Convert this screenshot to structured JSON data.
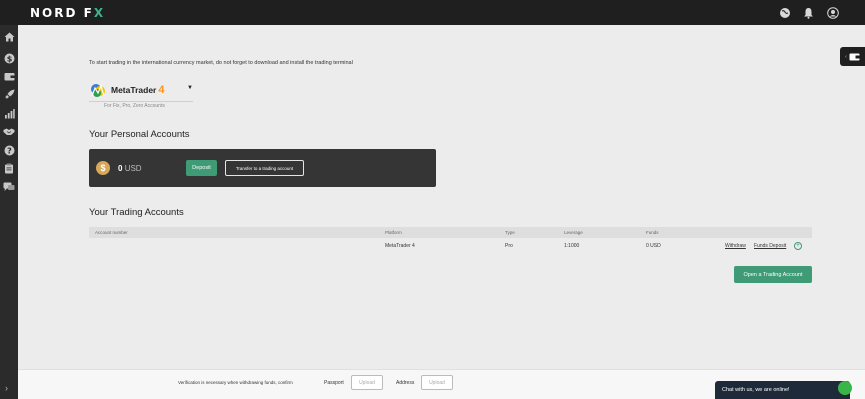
{
  "app": {
    "logo_left": "NORD F",
    "logo_right": "X"
  },
  "topbar": {
    "icons": [
      "globe-icon",
      "bell-icon",
      "user-icon"
    ]
  },
  "sidebar": {
    "icons": [
      "home-icon",
      "dollar-icon",
      "wallet-icon",
      "rocket-icon",
      "chart-icon",
      "handshake-icon",
      "help-icon",
      "clipboard-icon",
      "chat-icon"
    ],
    "expand": "›"
  },
  "intro": "To start trading in the international currency market, do not forget to download and install the trading terminal",
  "platform": {
    "name": "MetaTrader",
    "version": "4",
    "subtitle": "For Fix, Pro, Zero Accounts"
  },
  "personal": {
    "heading": "Your Personal Accounts",
    "balance": "0",
    "currency": "USD",
    "deposit_label": "Deposit",
    "transfer_label": "Transfer to a trading account"
  },
  "trading": {
    "heading": "Your Trading Accounts",
    "columns": [
      "Account number",
      "Platform",
      "Type",
      "Leverage",
      "Funds"
    ],
    "rows": [
      {
        "account": "",
        "platform": "MetaTrader 4",
        "type": "Pro",
        "leverage": "1:1000",
        "funds": "0 USD",
        "withdraw": "Withdraw",
        "deposit": "Funds Deposit"
      }
    ],
    "open_label": "Open a Trading Account"
  },
  "footer": {
    "text": "Verification is necessary when withdrawing funds, confirm",
    "passport": "Passport",
    "address": "Address",
    "upload": "Upload"
  },
  "chat": {
    "label": "Chat with us, we are online!"
  },
  "colors": {
    "accent": "#3f9a76",
    "dark": "#1f1f1f",
    "card": "#353535"
  }
}
